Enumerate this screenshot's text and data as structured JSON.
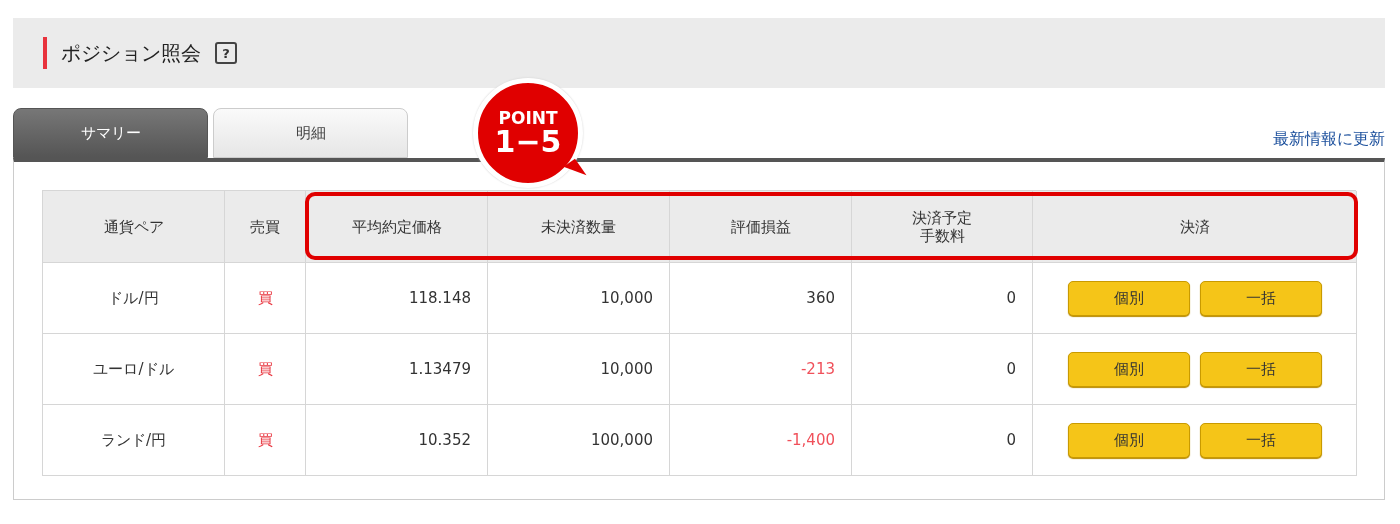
{
  "header": {
    "title": "ポジション照会",
    "help": "?"
  },
  "tabs": [
    {
      "label": "サマリー",
      "selected": true
    },
    {
      "label": "明細",
      "selected": false
    }
  ],
  "badge": {
    "line1": "POINT",
    "line2": "1−5"
  },
  "refresh_link": "最新情報に更新",
  "table": {
    "columns": [
      "通貨ペア",
      "売買",
      "平均約定価格",
      "未決済数量",
      "評価損益",
      "決済予定手数料",
      "決済"
    ],
    "rows": [
      {
        "pair": "ドル/円",
        "side": "買",
        "avg_price": "118.148",
        "quantity": "10,000",
        "pnl": "360",
        "pnl_negative": false,
        "fee": "0",
        "actions": [
          "個別",
          "一括"
        ]
      },
      {
        "pair": "ユーロ/ドル",
        "side": "買",
        "avg_price": "1.13479",
        "quantity": "10,000",
        "pnl": "-213",
        "pnl_negative": true,
        "fee": "0",
        "actions": [
          "個別",
          "一括"
        ]
      },
      {
        "pair": "ランド/円",
        "side": "買",
        "avg_price": "10.352",
        "quantity": "100,000",
        "pnl": "-1,400",
        "pnl_negative": true,
        "fee": "0",
        "actions": [
          "個別",
          "一括"
        ]
      }
    ]
  }
}
